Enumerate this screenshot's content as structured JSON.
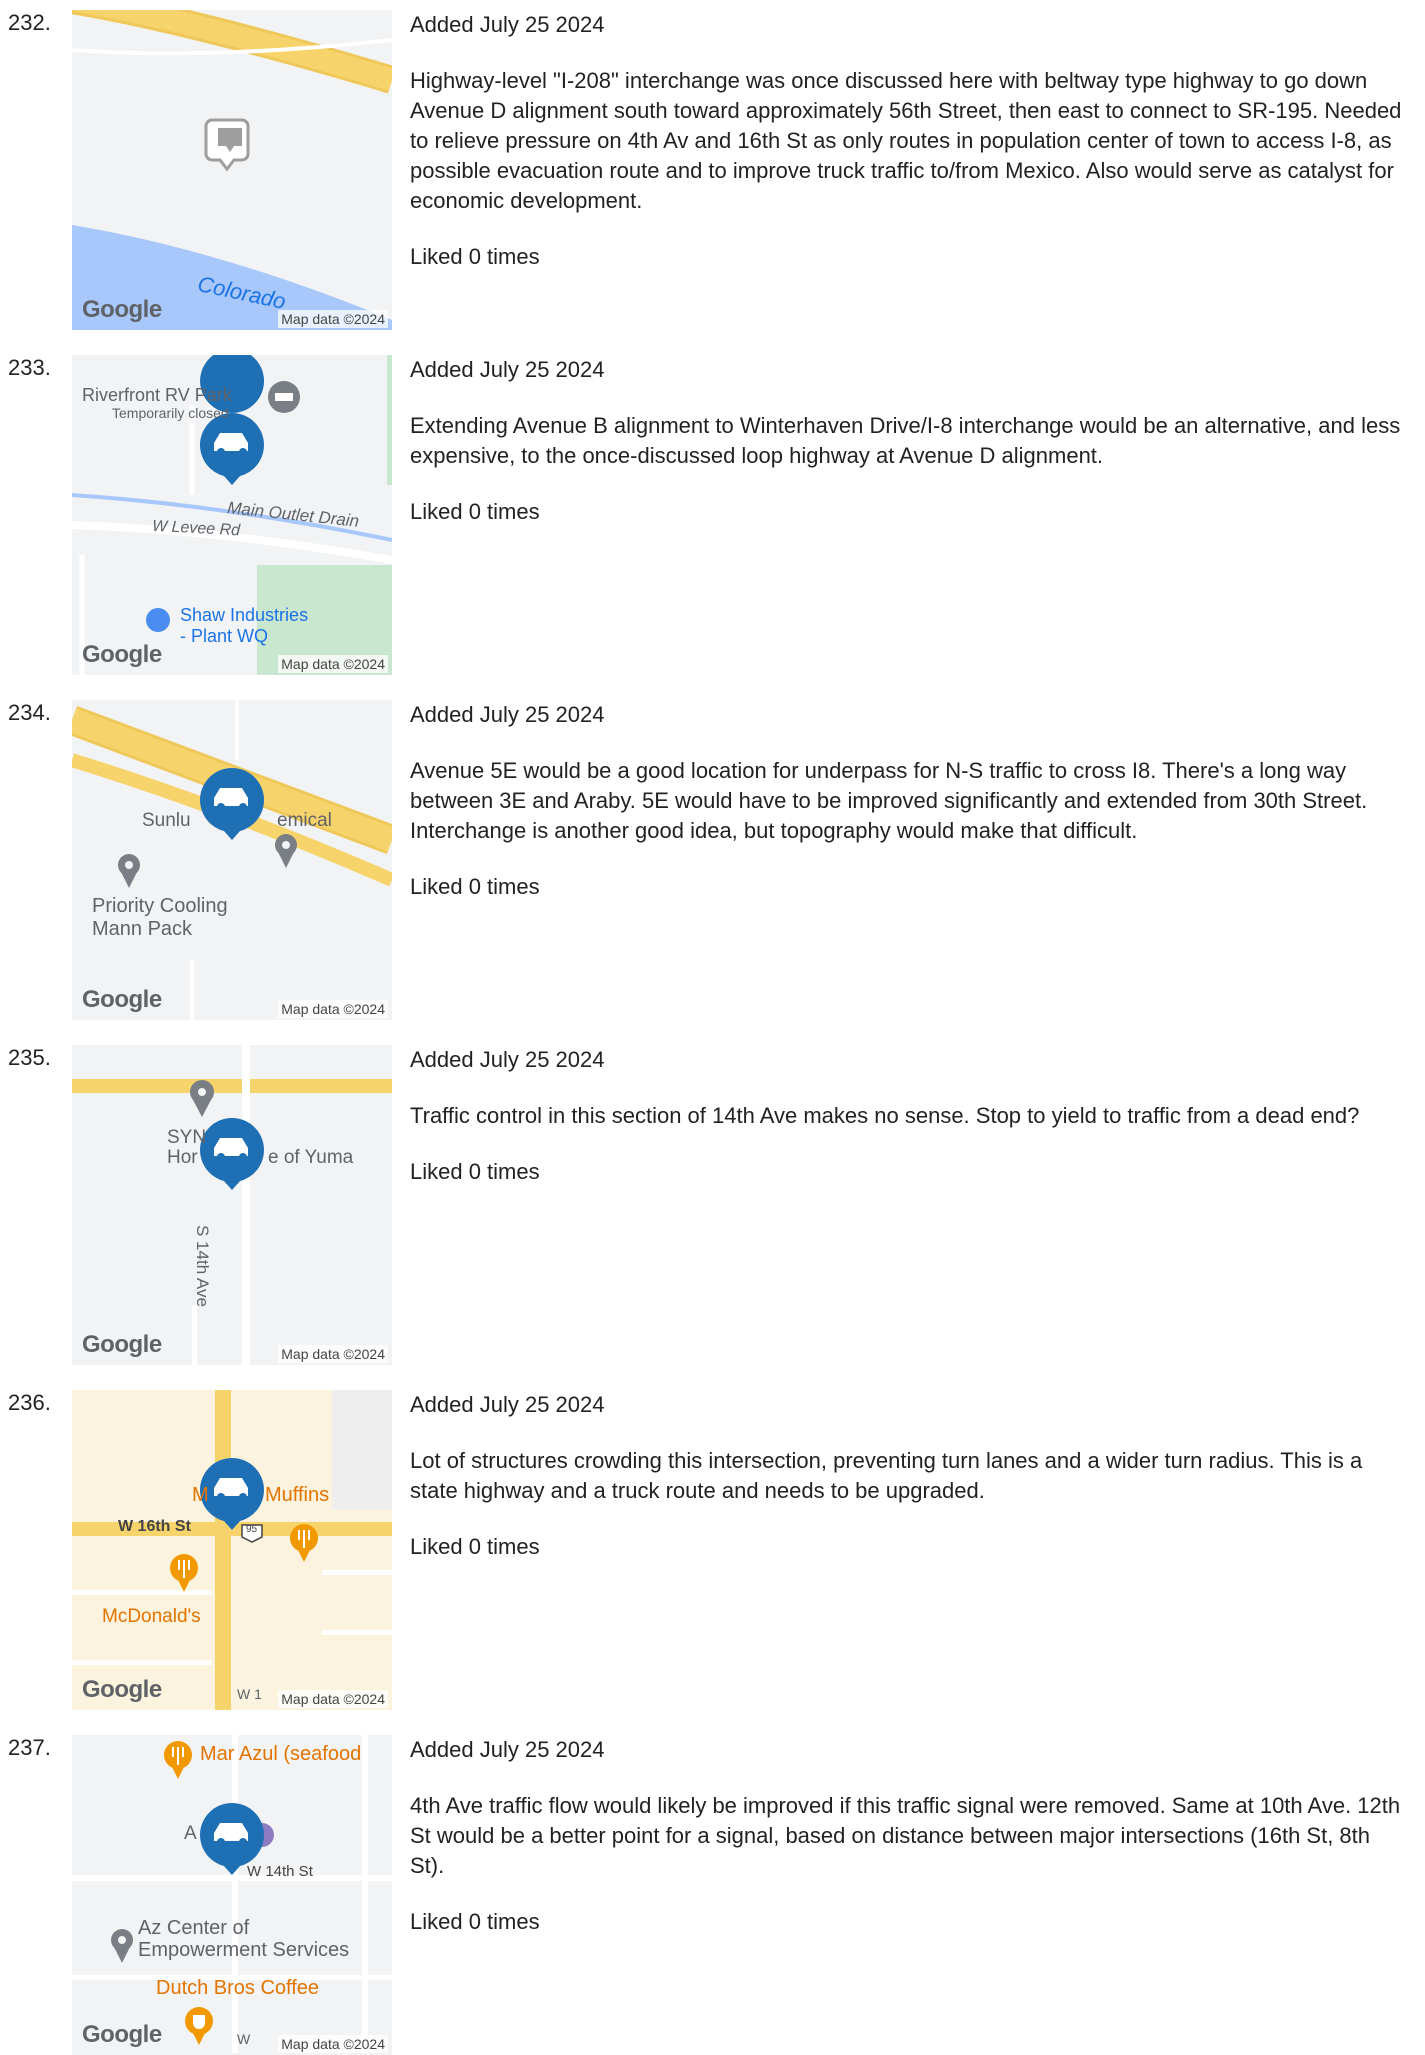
{
  "entries": [
    {
      "number": "232.",
      "date": "Added July 25 2024",
      "description": "Highway-level \"I-208\" interchange was once discussed here with beltway type highway to go down Avenue D alignment south toward approximately 56th Street, then east to connect to SR-195. Needed to relieve pressure on 4th Av and 16th St as only routes in population center of town to access I-8, as possible evacuation route and to improve truck traffic to/from Mexico. Also would serve as catalyst for economic development.",
      "likes": "Liked 0 times",
      "map": {
        "labels": [
          "Colorado"
        ],
        "logo": "Google",
        "attribution": "Map data ©2024",
        "marker_icon": "comment-icon"
      }
    },
    {
      "number": "233.",
      "date": "Added July 25 2024",
      "description": "Extending Avenue B alignment to Winterhaven Drive/I-8 interchange would be an alternative, and less expensive, to the once-discussed loop highway at Avenue D alignment.",
      "likes": "Liked 0 times",
      "map": {
        "labels": [
          "Riverfront RV Park",
          "Temporarily closed",
          "Main Outlet Drain",
          "W Levee Rd",
          "Shaw Industries",
          "- Plant WQ"
        ],
        "logo": "Google",
        "attribution": "Map data ©2024",
        "marker_icon": "car-icon"
      }
    },
    {
      "number": "234.",
      "date": "Added July 25 2024",
      "description": "Avenue 5E would be a good location for underpass for N-S traffic to cross I8. There's a long way between 3E and Araby. 5E would have to be improved significantly and extended from 30th Street. Interchange is another good idea, but topography would make that difficult.",
      "likes": "Liked 0 times",
      "map": {
        "labels": [
          "Sunlu",
          "emical",
          "Priority Cooling",
          "Mann Pack"
        ],
        "logo": "Google",
        "attribution": "Map data ©2024",
        "marker_icon": "car-icon"
      }
    },
    {
      "number": "235.",
      "date": "Added July 25 2024",
      "description": "Traffic control in this section of 14th Ave makes no sense. Stop to yield to traffic from a dead end?",
      "likes": "Liked 0 times",
      "map": {
        "labels": [
          "SYN",
          "Hor",
          "e of Yuma",
          "S 14th Ave"
        ],
        "logo": "Google",
        "attribution": "Map data ©2024",
        "marker_icon": "car-icon"
      }
    },
    {
      "number": "236.",
      "date": "Added July 25 2024",
      "description": "Lot of structures crowding this intersection, preventing turn lanes and a wider turn radius. This is a state highway and a truck route and needs to be upgraded.",
      "likes": "Liked 0 times",
      "map": {
        "labels": [
          "M",
          "Muffins",
          "W 16th St",
          "95",
          "McDonald's",
          "W 1"
        ],
        "logo": "Google",
        "attribution": "Map data ©2024",
        "marker_icon": "car-icon"
      }
    },
    {
      "number": "237.",
      "date": "Added July 25 2024",
      "description": "4th Ave traffic flow would likely be improved if this traffic signal were removed. Same at 10th Ave. 12th St would be a better point for a signal, based on distance between major intersections (16th St, 8th St).",
      "likes": "Liked 0 times",
      "map": {
        "labels": [
          "Mar Azul (seafood",
          "A",
          "W 14th St",
          "Az Center of",
          "Empowerment Services",
          "Dutch Bros Coffee",
          "W"
        ],
        "logo": "Google",
        "attribution": "Map data ©2024",
        "marker_icon": "car-icon"
      }
    }
  ],
  "colors": {
    "marker": "#1f6fb5",
    "highway": "#f7d46b",
    "water": "#a8c7fa",
    "park": "#c9e7cf",
    "map_bg": "#f2f3f4"
  }
}
